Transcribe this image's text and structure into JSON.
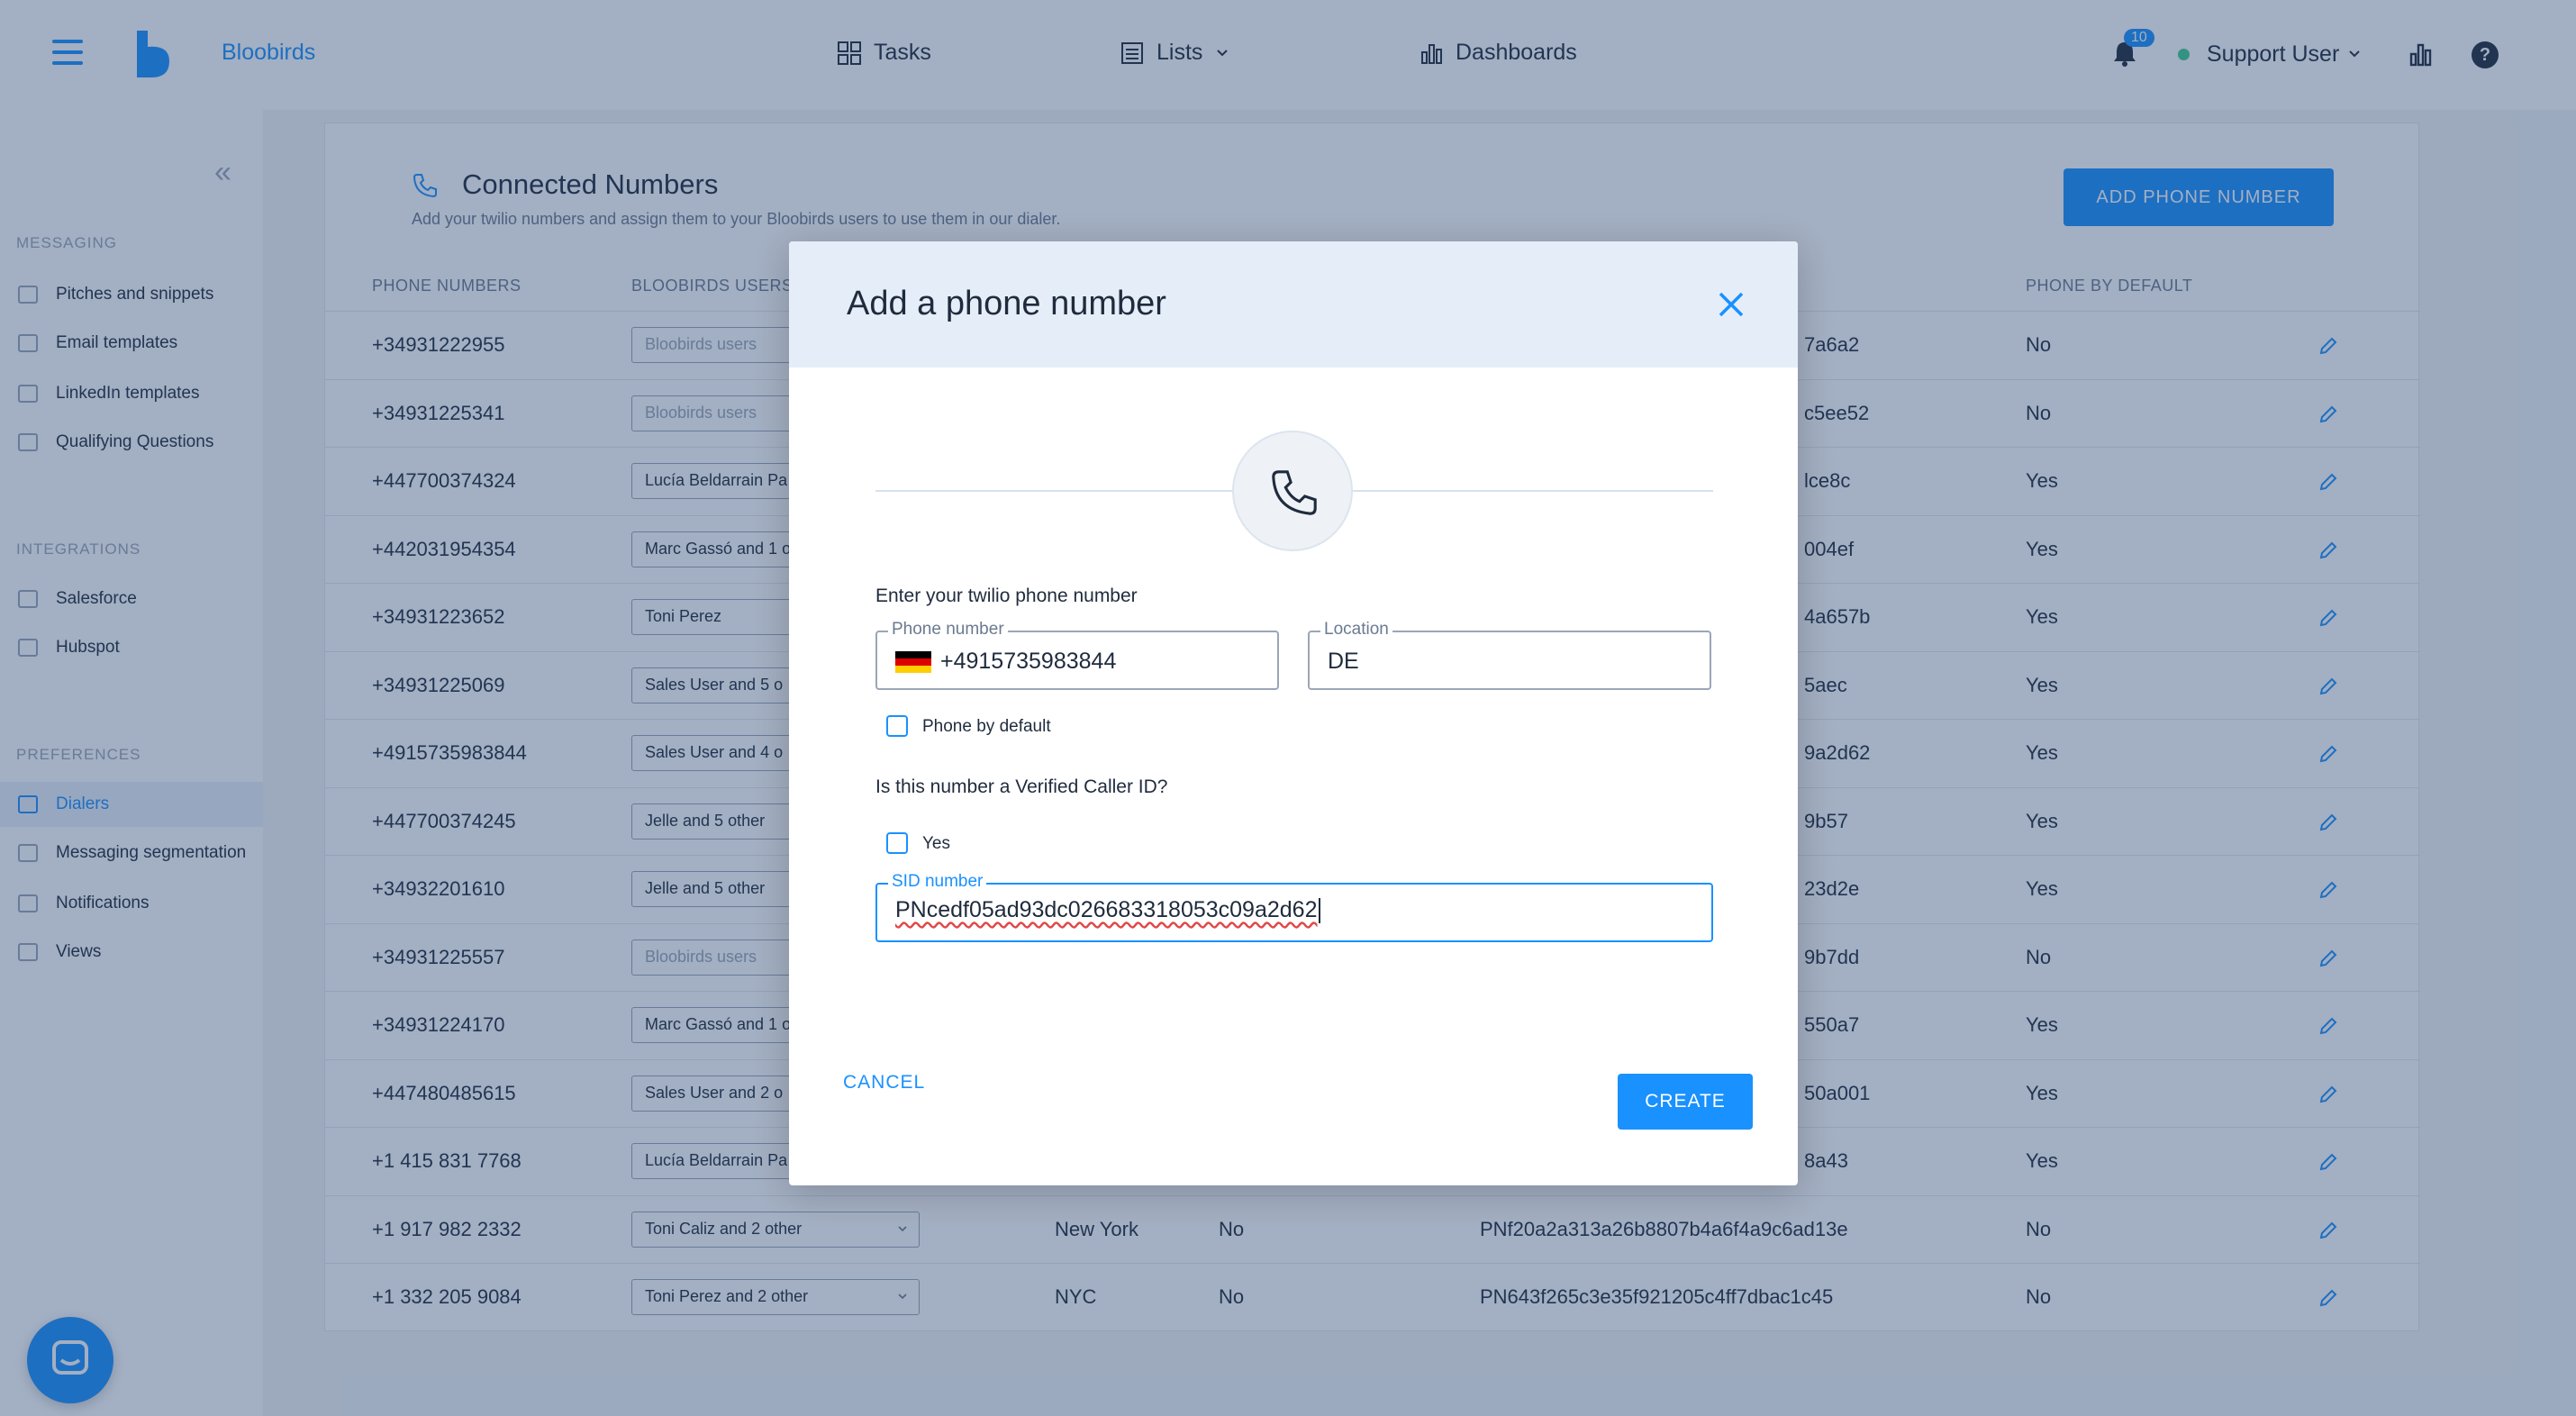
{
  "header": {
    "brand": "Bloobirds",
    "nav": [
      {
        "label": "Tasks",
        "icon": "grid-icon"
      },
      {
        "label": "Lists",
        "icon": "list-icon"
      },
      {
        "label": "Dashboards",
        "icon": "bar-chart-icon"
      }
    ],
    "notifications_count": "10",
    "user_name": "Support User",
    "help_label": "?"
  },
  "sidebar": {
    "collapse_label": "«",
    "sections": [
      {
        "title": "MESSAGING",
        "items": [
          "Pitches and snippets",
          "Email templates",
          "LinkedIn templates",
          "Qualifying Questions"
        ]
      },
      {
        "title": "INTEGRATIONS",
        "items": [
          "Salesforce",
          "Hubspot"
        ]
      },
      {
        "title": "PREFERENCES",
        "items": [
          "Dialers",
          "Messaging segmentation",
          "Notifications",
          "Views"
        ]
      }
    ],
    "active_item": "Dialers"
  },
  "page": {
    "title": "Connected Numbers",
    "subtitle": "Add your twilio numbers and assign them to your Bloobirds users to use them in our dialer.",
    "add_button": "ADD PHONE NUMBER",
    "columns": [
      "PHONE NUMBERS",
      "BLOOBIRDS USERS",
      "PHONE BY DEFAULT"
    ],
    "rows": [
      {
        "phone": "+34931222955",
        "users": "Bloobirds users",
        "placeholder": true,
        "location": "",
        "verified": "",
        "sid": "7a6a2",
        "default": "No"
      },
      {
        "phone": "+34931225341",
        "users": "Bloobirds users",
        "placeholder": true,
        "location": "",
        "verified": "",
        "sid": "c5ee52",
        "default": "No"
      },
      {
        "phone": "+447700374324",
        "users": "Lucía Beldarrain Pa",
        "placeholder": false,
        "location": "",
        "verified": "",
        "sid": "lce8c",
        "default": "Yes"
      },
      {
        "phone": "+442031954354",
        "users": "Marc Gassó and 1 o",
        "placeholder": false,
        "location": "",
        "verified": "",
        "sid": "004ef",
        "default": "Yes"
      },
      {
        "phone": "+34931223652",
        "users": "Toni Perez",
        "placeholder": false,
        "location": "",
        "verified": "",
        "sid": "4a657b",
        "default": "Yes"
      },
      {
        "phone": "+34931225069",
        "users": "Sales User and 5 o",
        "placeholder": false,
        "location": "",
        "verified": "",
        "sid": "5aec",
        "default": "Yes"
      },
      {
        "phone": "+4915735983844",
        "users": "Sales User and 4 o",
        "placeholder": false,
        "location": "",
        "verified": "",
        "sid": "9a2d62",
        "default": "Yes"
      },
      {
        "phone": "+447700374245",
        "users": "Jelle and 5 other",
        "placeholder": false,
        "location": "",
        "verified": "",
        "sid": "9b57",
        "default": "Yes"
      },
      {
        "phone": "+34932201610",
        "users": "Jelle and 5 other",
        "placeholder": false,
        "location": "",
        "verified": "",
        "sid": "23d2e",
        "default": "Yes"
      },
      {
        "phone": "+34931225557",
        "users": "Bloobirds users",
        "placeholder": true,
        "location": "",
        "verified": "",
        "sid": "9b7dd",
        "default": "No"
      },
      {
        "phone": "+34931224170",
        "users": "Marc Gassó and 1 o",
        "placeholder": false,
        "location": "",
        "verified": "",
        "sid": "550a7",
        "default": "Yes"
      },
      {
        "phone": "+447480485615",
        "users": "Sales User and 2 o",
        "placeholder": false,
        "location": "",
        "verified": "",
        "sid": "50a001",
        "default": "Yes"
      },
      {
        "phone": "+1 415 831 7768",
        "users": "Lucía Beldarrain Pa",
        "placeholder": false,
        "location": "",
        "verified": "",
        "sid": "8a43",
        "default": "Yes"
      },
      {
        "phone": "+1 917 982 2332",
        "users": "Toni Caliz and 2 other",
        "placeholder": false,
        "location": "New York",
        "verified": "No",
        "sid": "PNf20a2a313a26b8807b4a6f4a9c6ad13e",
        "default": "No"
      },
      {
        "phone": "+1 332 205 9084",
        "users": "Toni Perez and 2 other",
        "placeholder": false,
        "location": "NYC",
        "verified": "No",
        "sid": "PN643f265c3e35f921205c4ff7dbac1c45",
        "default": "No"
      }
    ]
  },
  "modal": {
    "title": "Add a phone number",
    "section_label": "Enter your twilio phone number",
    "phone_label": "Phone number",
    "phone_value": "+4915735983844",
    "location_label": "Location",
    "location_value": "DE",
    "phone_default_label": "Phone by default",
    "verified_question": "Is this number a Verified Caller ID?",
    "yes_label": "Yes",
    "sid_label": "SID number",
    "sid_value": "PNcedf05ad93dc026683318053c09a2d62",
    "cancel": "CANCEL",
    "create": "CREATE"
  },
  "colors": {
    "accent": "#1991ff",
    "overlay": "#23416e"
  }
}
